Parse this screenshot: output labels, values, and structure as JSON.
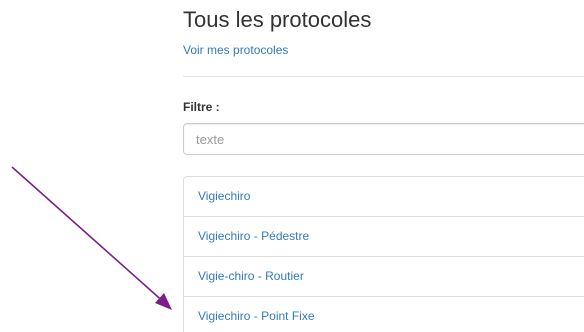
{
  "header": {
    "title": "Tous les protocoles",
    "my_protocols_link": "Voir mes protocoles"
  },
  "filter": {
    "label": "Filtre :",
    "placeholder": "texte",
    "value": ""
  },
  "protocols": [
    {
      "label": "Vigiechiro"
    },
    {
      "label": "Vigiechiro - Pédestre"
    },
    {
      "label": "Vigie-chiro - Routier"
    },
    {
      "label": "Vigiechiro - Point Fixe"
    }
  ],
  "annotation": {
    "arrow_color": "#7b1f8c",
    "arrow_target": "Vigiechiro - Point Fixe"
  }
}
